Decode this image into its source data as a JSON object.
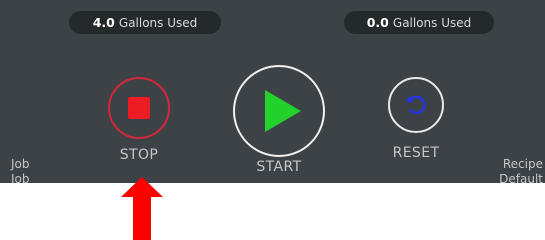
{
  "gallons_left": {
    "value": "4.0",
    "unit": "Gallons Used"
  },
  "gallons_right": {
    "value": "0.0",
    "unit": "Gallons Used"
  },
  "controls": {
    "stop_label": "STOP",
    "start_label": "START",
    "reset_label": "RESET"
  },
  "side_left": {
    "line1": "Job",
    "line2": "Job"
  },
  "side_right": {
    "line1": "Recipe",
    "line2": "Default"
  },
  "icons": {
    "stop": "stop-square-icon",
    "start": "play-triangle-icon",
    "reset": "rotate-ccw-icon",
    "pointer": "up-arrow-icon"
  },
  "colors": {
    "panel_bg": "#3d4246",
    "pill_bg": "#24292c",
    "stop_red": "#ec1c24",
    "start_green": "#22d12c",
    "reset_blue": "#2633e8",
    "annotation_arrow": "#ff0000"
  }
}
